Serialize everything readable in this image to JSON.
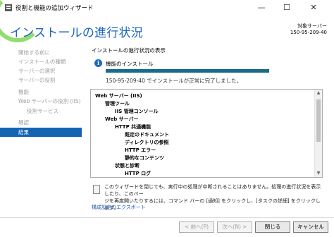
{
  "window": {
    "title": "役割と機能の追加ウィザード",
    "controls": {
      "minimize": "—",
      "maximize": "☐",
      "close": "✕"
    }
  },
  "header": {
    "page_title": "インストールの進行状況",
    "target_label": "対象サーバー",
    "target_value": "150-95-209-40"
  },
  "sidebar": {
    "items": [
      {
        "label": "開始する前に",
        "state": "disabled"
      },
      {
        "label": "インストールの種類",
        "state": "disabled"
      },
      {
        "label": "サーバーの選択",
        "state": "disabled"
      },
      {
        "label": "サーバーの役割",
        "state": "disabled"
      },
      {
        "label": "機能",
        "state": "disabled"
      },
      {
        "label": "Web サーバーの役割 (IIS)",
        "state": "disabled"
      },
      {
        "label": "役割サービス",
        "state": "disabled"
      },
      {
        "label": "確認",
        "state": "disabled"
      },
      {
        "label": "結果",
        "state": "active"
      }
    ]
  },
  "main": {
    "section_label": "インストールの進行状況の表示",
    "status_text": "機能のインストール",
    "progress": 1.0,
    "result_text": "150-95-209-40 でインストールが正常に完了しました。",
    "results_tree": [
      {
        "label": "Web サーバー (IIS)",
        "level": 0
      },
      {
        "label": "管理ツール",
        "level": 1
      },
      {
        "label": "IIS 管理コンソール",
        "level": 2
      },
      {
        "label": "Web サーバー",
        "level": 1
      },
      {
        "label": "HTTP 共通機能",
        "level": 2
      },
      {
        "label": "既定のドキュメント",
        "level": 3
      },
      {
        "label": "ディレクトリの参照",
        "level": 3
      },
      {
        "label": "HTTP エラー",
        "level": 3
      },
      {
        "label": "静的なコンテンツ",
        "level": 3
      },
      {
        "label": "状態と診断",
        "level": 2
      },
      {
        "label": "HTTP ログ",
        "level": 3
      }
    ],
    "note_line1": "このウィザードを閉じても、実行中の処理が中断されることはありません。処理の進行状況を表示したり、このペー",
    "note_line2": "ジを再度開いたりするには、コマンド バーの [通知] をクリックし、[タスクの詳細] をクリックします。",
    "export_link": "構成設定のエクスポート"
  },
  "footer": {
    "prev_label": "< 前へ(P)",
    "next_label": "次へ(N) >",
    "close_label": "閉じる",
    "cancel_label": "キャンセル"
  },
  "colors": {
    "accent": "#1a66c0",
    "selected": "#1464b4",
    "progress": "#1a6a8a",
    "highlight_ring": "#7ed957"
  }
}
